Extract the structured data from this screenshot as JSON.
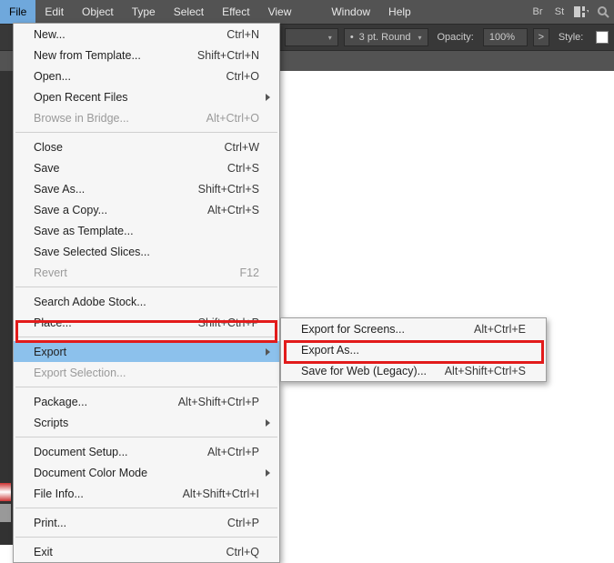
{
  "menubar": {
    "items": [
      "File",
      "Edit",
      "Object",
      "Type",
      "Select",
      "Effect",
      "View",
      "Window",
      "Help"
    ],
    "icons": [
      "Br",
      "St"
    ]
  },
  "toolbar": {
    "stroke_value": "3 pt. Round",
    "opacity_label": "Opacity:",
    "opacity_value": "100%",
    "style_label": "Style:"
  },
  "file_menu": [
    {
      "label": "New...",
      "shortcut": "Ctrl+N"
    },
    {
      "label": "New from Template...",
      "shortcut": "Shift+Ctrl+N"
    },
    {
      "label": "Open...",
      "shortcut": "Ctrl+O"
    },
    {
      "label": "Open Recent Files",
      "sub": true
    },
    {
      "label": "Browse in Bridge...",
      "shortcut": "Alt+Ctrl+O",
      "disabled": true
    },
    {
      "sep": true
    },
    {
      "label": "Close",
      "shortcut": "Ctrl+W"
    },
    {
      "label": "Save",
      "shortcut": "Ctrl+S"
    },
    {
      "label": "Save As...",
      "shortcut": "Shift+Ctrl+S"
    },
    {
      "label": "Save a Copy...",
      "shortcut": "Alt+Ctrl+S"
    },
    {
      "label": "Save as Template..."
    },
    {
      "label": "Save Selected Slices..."
    },
    {
      "label": "Revert",
      "shortcut": "F12",
      "disabled": true
    },
    {
      "sep": true
    },
    {
      "label": "Search Adobe Stock..."
    },
    {
      "label": "Place...",
      "shortcut": "Shift+Ctrl+P"
    },
    {
      "sep": true
    },
    {
      "label": "Export",
      "sub": true,
      "highlight": true
    },
    {
      "label": "Export Selection...",
      "disabled": true
    },
    {
      "sep": true
    },
    {
      "label": "Package...",
      "shortcut": "Alt+Shift+Ctrl+P"
    },
    {
      "label": "Scripts",
      "sub": true
    },
    {
      "sep": true
    },
    {
      "label": "Document Setup...",
      "shortcut": "Alt+Ctrl+P"
    },
    {
      "label": "Document Color Mode",
      "sub": true
    },
    {
      "label": "File Info...",
      "shortcut": "Alt+Shift+Ctrl+I"
    },
    {
      "sep": true
    },
    {
      "label": "Print...",
      "shortcut": "Ctrl+P"
    },
    {
      "sep": true
    },
    {
      "label": "Exit",
      "shortcut": "Ctrl+Q"
    }
  ],
  "export_menu": [
    {
      "label": "Export for Screens...",
      "shortcut": "Alt+Ctrl+E"
    },
    {
      "label": "Export As..."
    },
    {
      "label": "Save for Web (Legacy)...",
      "shortcut": "Alt+Shift+Ctrl+S"
    }
  ]
}
